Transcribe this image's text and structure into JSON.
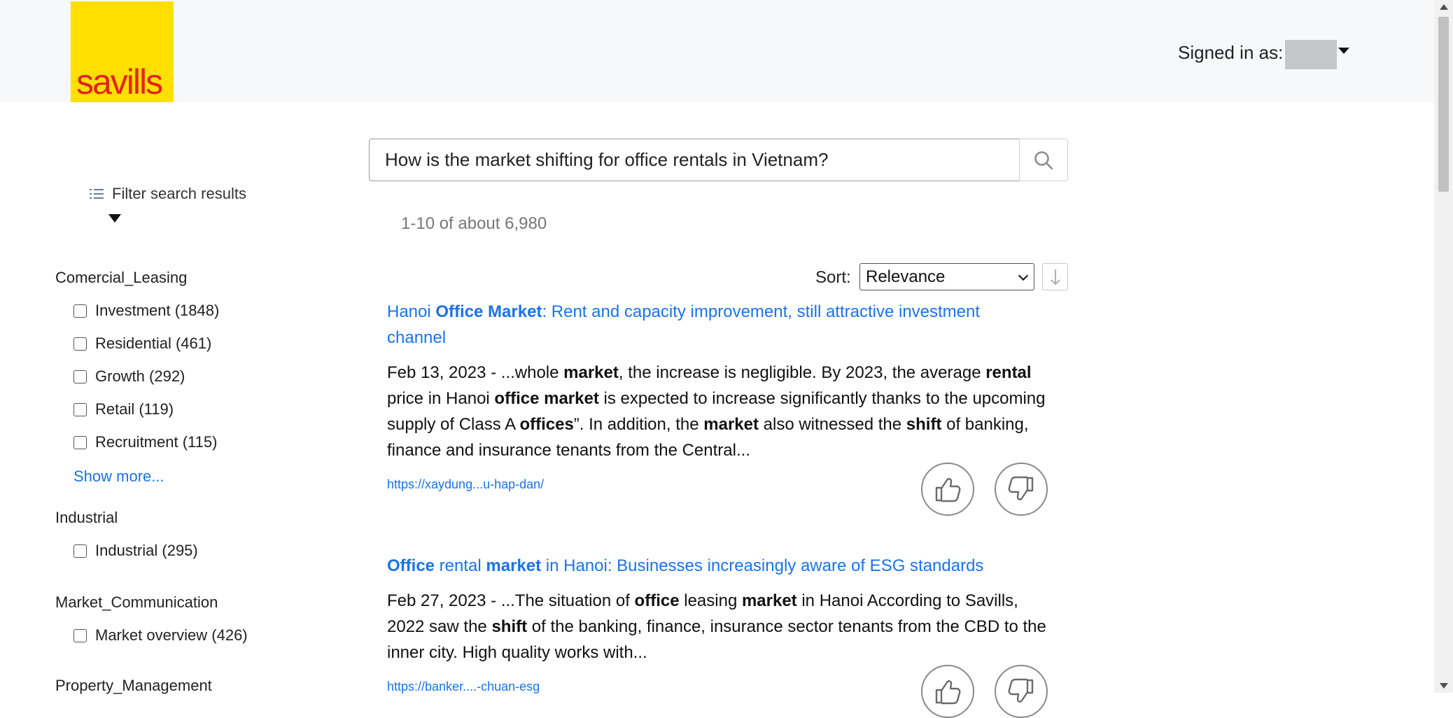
{
  "header": {
    "logo_text": "savills",
    "signed_in_label": "Signed in as:"
  },
  "search": {
    "query": "How is the market shifting for office rentals in Vietnam?",
    "result_count": "1-10 of about 6,980"
  },
  "sidebar": {
    "filter_label": "Filter search results",
    "show_more": "Show more...",
    "groups": [
      {
        "title": "Comercial_Leasing",
        "items": [
          "Investment (1848)",
          "Residential (461)",
          "Growth (292)",
          "Retail (119)",
          "Recruitment (115)"
        ]
      },
      {
        "title": "Industrial",
        "items": [
          "Industrial (295)"
        ]
      },
      {
        "title": "Market_Communication",
        "items": [
          "Market overview (426)"
        ]
      },
      {
        "title": "Property_Management",
        "items": []
      }
    ]
  },
  "sort": {
    "label": "Sort:",
    "selected": "Relevance",
    "direction_icon": "arrow-down"
  },
  "results": [
    {
      "title_parts": [
        {
          "t": "Hanoi ",
          "b": false
        },
        {
          "t": "Office Market",
          "b": true
        },
        {
          "t": ": Rent and capacity improvement, still attractive investment channel",
          "b": false
        }
      ],
      "snippet_parts": [
        {
          "t": "Feb 13, 2023 - ...whole ",
          "b": false
        },
        {
          "t": "market",
          "b": true
        },
        {
          "t": ", the increase is negligible. By 2023, the average ",
          "b": false
        },
        {
          "t": "rental",
          "b": true
        },
        {
          "t": " price in Hanoi ",
          "b": false
        },
        {
          "t": "office market",
          "b": true
        },
        {
          "t": " is expected to increase significantly thanks to the upcoming supply of Class A ",
          "b": false
        },
        {
          "t": "offices",
          "b": true
        },
        {
          "t": "”. In addition, the ",
          "b": false
        },
        {
          "t": "market",
          "b": true
        },
        {
          "t": " also witnessed the ",
          "b": false
        },
        {
          "t": "shift",
          "b": true
        },
        {
          "t": " of banking, finance and insurance tenants from the Central...",
          "b": false
        }
      ],
      "url": "https://xaydung...u-hap-dan/"
    },
    {
      "title_parts": [
        {
          "t": "Office",
          "b": true
        },
        {
          "t": " rental ",
          "b": false
        },
        {
          "t": "market",
          "b": true
        },
        {
          "t": " in Hanoi: Businesses increasingly aware of ESG standards",
          "b": false
        }
      ],
      "snippet_parts": [
        {
          "t": "Feb 27, 2023 - ...The situation of ",
          "b": false
        },
        {
          "t": "office",
          "b": true
        },
        {
          "t": " leasing ",
          "b": false
        },
        {
          "t": "market",
          "b": true
        },
        {
          "t": " in Hanoi According to Savills, 2022 saw the ",
          "b": false
        },
        {
          "t": "shift",
          "b": true
        },
        {
          "t": " of the banking, finance, insurance sector tenants from the CBD to the inner city. High quality works with...",
          "b": false
        }
      ],
      "url": "https://banker....-chuan-esg"
    }
  ],
  "icons": {
    "search": "search-icon",
    "thumbs_up": "thumbs-up-icon",
    "thumbs_down": "thumbs-down-icon",
    "filter": "list-icon"
  },
  "colors": {
    "brand_yellow": "#ffdf00",
    "brand_red": "#e2231a",
    "link_blue": "#1a73e8"
  }
}
